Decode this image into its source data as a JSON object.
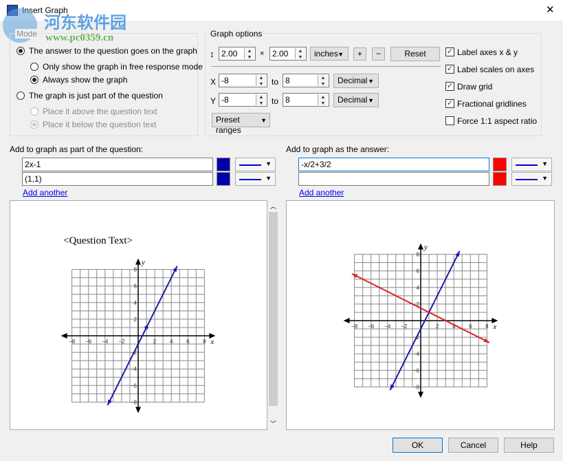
{
  "window": {
    "title": "Insert Graph",
    "close_glyph": "✕"
  },
  "watermark": {
    "name": "河东软件园",
    "url": "www.pc0359.cn"
  },
  "mode": {
    "legend": "Mode",
    "options": [
      {
        "label": "The answer to the question goes on the graph",
        "selected": true,
        "enabled": true
      },
      {
        "label": "Only show the graph in free response mode",
        "selected": false,
        "enabled": true
      },
      {
        "label": "Always show the graph",
        "selected": true,
        "enabled": true
      },
      {
        "label": "The graph is just part of the question",
        "selected": false,
        "enabled": true
      },
      {
        "label": "Place it above the question text",
        "selected": false,
        "enabled": false
      },
      {
        "label": "Place it below the question text",
        "selected": true,
        "enabled": false
      }
    ]
  },
  "graph_options": {
    "legend": "Graph options",
    "size_icon": "↕",
    "width": "2.00",
    "times": "×",
    "height": "2.00",
    "unit": "inches",
    "plus": "+",
    "minus": "−",
    "reset": "Reset",
    "x_label": "X",
    "x_from": "-8",
    "x_to": "8",
    "x_format": "Decimal",
    "to_label": "to",
    "y_label": "Y",
    "y_from": "-8",
    "y_to": "8",
    "y_format": "Decimal",
    "preset": "Preset ranges",
    "checks": [
      {
        "label": "Label axes x & y",
        "checked": true
      },
      {
        "label": "Label scales on axes",
        "checked": true
      },
      {
        "label": "Draw grid",
        "checked": true
      },
      {
        "label": "Fractional gridlines",
        "checked": true
      },
      {
        "label": "Force 1:1 aspect ratio",
        "checked": false
      }
    ]
  },
  "question": {
    "label": "Add to graph as part of the question:",
    "items": [
      {
        "value": "2x-1",
        "color": "#0000a8"
      },
      {
        "value": "(1,1)",
        "color": "#0000a8"
      }
    ],
    "add": "Add another",
    "preview_text": "<Question Text>"
  },
  "answer": {
    "label": "Add to graph as the answer:",
    "items": [
      {
        "value": "-x/2+3/2",
        "color": "#ff0000"
      },
      {
        "value": "",
        "color": "#ff0000"
      }
    ],
    "add": "Add another"
  },
  "chart_data": [
    {
      "type": "line",
      "xlim": [
        -8,
        8
      ],
      "ylim": [
        -8,
        8
      ],
      "grid": true,
      "xlabel": "x",
      "ylabel": "y",
      "ticks": [
        "−8",
        "−6",
        "−4",
        "−2",
        "2",
        "4",
        "6",
        "8"
      ],
      "series": [
        {
          "expr": "2x-1",
          "color": "#1a1aa8"
        }
      ],
      "points": [
        [
          1,
          1
        ]
      ]
    },
    {
      "type": "line",
      "xlim": [
        -8,
        8
      ],
      "ylim": [
        -8,
        8
      ],
      "grid": true,
      "xlabel": "x",
      "ylabel": "y",
      "ticks": [
        "−8",
        "−6",
        "−4",
        "−2",
        "2",
        "4",
        "6",
        "8"
      ],
      "series": [
        {
          "expr": "2x-1",
          "color": "#1a1aa8"
        },
        {
          "expr": "-x/2+3/2",
          "color": "#e02020"
        }
      ],
      "points": []
    }
  ],
  "buttons": {
    "ok": "OK",
    "cancel": "Cancel",
    "help": "Help"
  }
}
